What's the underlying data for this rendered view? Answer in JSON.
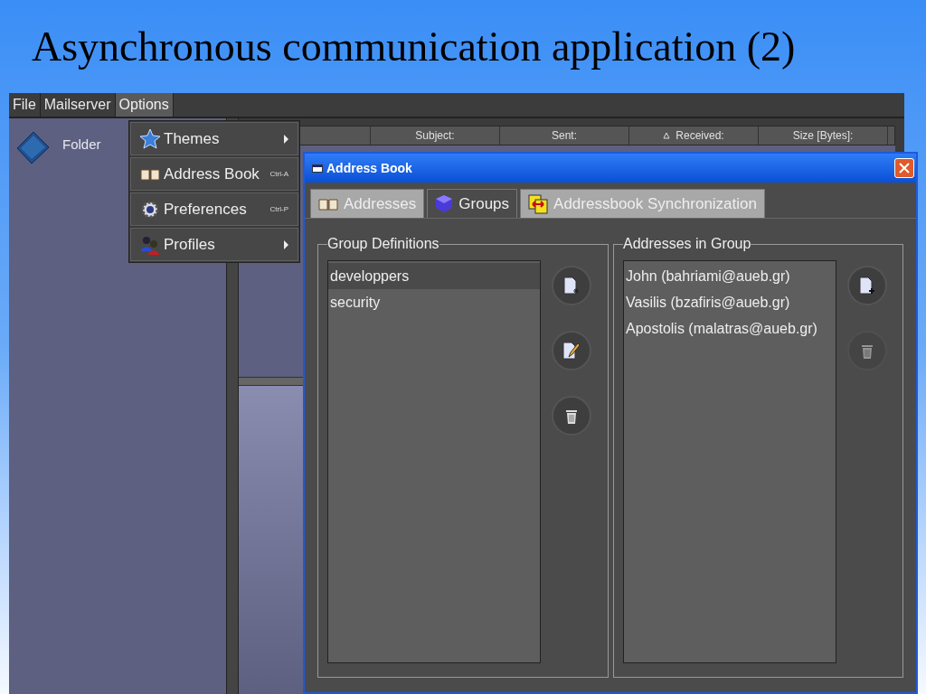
{
  "slide": {
    "title": "Asynchronous communication application (2)"
  },
  "menu_bar": [
    {
      "label": "File",
      "selected": false
    },
    {
      "label": "Mailserver",
      "selected": false
    },
    {
      "label": "Options",
      "selected": true
    }
  ],
  "sidebar": {
    "items": [
      {
        "label": "Folder"
      }
    ]
  },
  "options_menu": [
    {
      "kind": "submenu",
      "label": "Themes"
    },
    {
      "kind": "shortcut",
      "label": "Address Book",
      "shortcut": "Ctrl-A"
    },
    {
      "kind": "shortcut",
      "label": "Preferences",
      "shortcut": "Ctrl-P"
    },
    {
      "kind": "submenu",
      "label": "Profiles"
    }
  ],
  "message_table": {
    "columns": [
      {
        "label": "Subject:",
        "sorted": false
      },
      {
        "label": "Sent:",
        "sorted": false
      },
      {
        "label": "Received:",
        "sorted": true
      },
      {
        "label": "Size [Bytes]:",
        "sorted": false
      }
    ]
  },
  "dialog": {
    "title": "Address Book",
    "tabs": [
      {
        "label": "Addresses",
        "selected": false
      },
      {
        "label": "Groups",
        "selected": true
      },
      {
        "label": "Addressbook Synchronization",
        "selected": false
      }
    ],
    "group_definitions": {
      "title": "Group Definitions",
      "items": [
        {
          "label": "developpers",
          "selected": true
        },
        {
          "label": "security",
          "selected": false
        }
      ],
      "buttons": [
        {
          "kind": "new",
          "disabled": false
        },
        {
          "kind": "edit",
          "disabled": false
        },
        {
          "kind": "delete",
          "disabled": false
        }
      ]
    },
    "addresses_in_group": {
      "title": "Addresses in Group",
      "items": [
        {
          "label": "John (bahriami@aueb.gr)",
          "selected": false
        },
        {
          "label": "Vasilis (bzafiris@aueb.gr)",
          "selected": false
        },
        {
          "label": "Apostolis (malatras@aueb.gr)",
          "selected": false
        }
      ],
      "buttons": [
        {
          "kind": "add",
          "disabled": false
        },
        {
          "kind": "delete",
          "disabled": true
        }
      ]
    }
  }
}
